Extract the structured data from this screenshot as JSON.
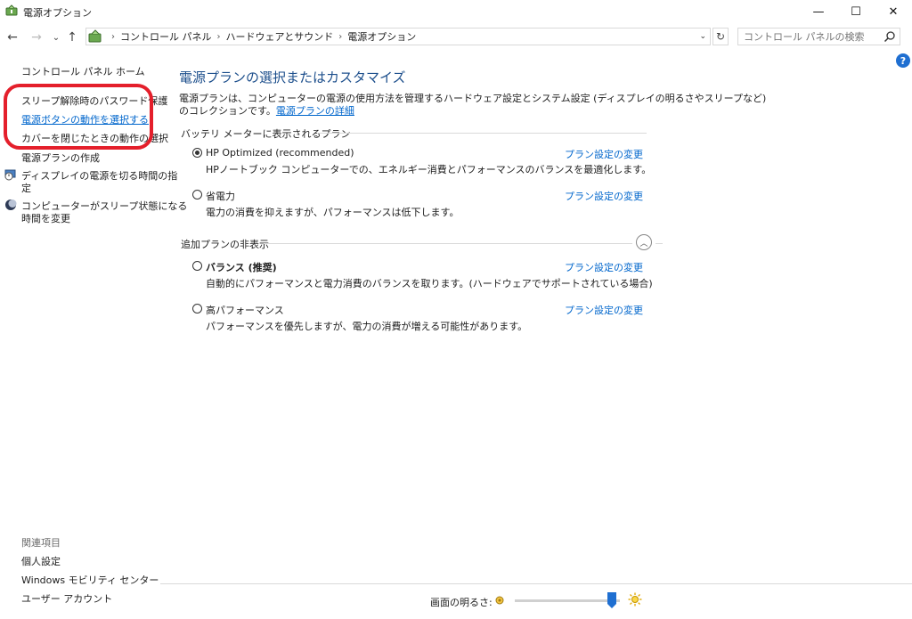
{
  "window": {
    "title": "電源オプション",
    "minimize": "—",
    "maximize": "☐",
    "close": "✕"
  },
  "nav": {
    "back": "←",
    "forward": "→",
    "recent": "⌄",
    "up": "↑"
  },
  "address": {
    "crumbs": [
      "コントロール パネル",
      "ハードウェアとサウンド",
      "電源オプション"
    ],
    "separator": "›",
    "dropdown": "⌄",
    "refresh": "↻"
  },
  "search": {
    "placeholder": "コントロール パネルの検索"
  },
  "help": "?",
  "sidebar": {
    "home": "コントロール パネル ホーム",
    "items": [
      "スリープ解除時のパスワード保護",
      "電源ボタンの動作を選択する",
      "カバーを閉じたときの動作の選択",
      "電源プランの作成",
      "ディスプレイの電源を切る時間の指定",
      "コンピューターがスリープ状態になる時間を変更"
    ],
    "item4_lines": [
      "ディスプレイの電源を切る時間の指",
      "定"
    ],
    "item5_lines": [
      "コンピューターがスリープ状態になる",
      "時間を変更"
    ],
    "related": {
      "heading": "関連項目",
      "links": [
        "個人設定",
        "Windows モビリティ センター",
        "ユーザー アカウント"
      ]
    }
  },
  "main": {
    "title": "電源プランの選択またはカスタマイズ",
    "description_line1": "電源プランは、コンピューターの電源の使用方法を管理するハードウェア設定とシステム設定 (ディスプレイの明るさやスリープなど)",
    "description_line2_prefix": "のコレクションです。",
    "description_link": "電源プランの詳細",
    "battery_section": "バッテリ メーターに表示されるプラン",
    "hidden_section": "追加プランの非表示",
    "change_link": "プラン設定の変更",
    "plans": [
      {
        "name": "HP Optimized (recommended)",
        "desc": "HPノートブック コンピューターでの、エネルギー消費とパフォーマンスのバランスを最適化します。",
        "selected": true
      },
      {
        "name": "省電力",
        "desc": "電力の消費を抑えますが、パフォーマンスは低下します。",
        "selected": false
      },
      {
        "name": "バランス (推奨)",
        "desc": "自動的にパフォーマンスと電力消費のバランスを取ります。(ハードウェアでサポートされている場合)",
        "selected": false
      },
      {
        "name": "高パフォーマンス",
        "desc": "パフォーマンスを優先しますが、電力の消費が増える可能性があります。",
        "selected": false
      }
    ]
  },
  "brightness": {
    "label": "画面の明るさ:",
    "level": 0.92
  },
  "colors": {
    "link": "#0066cc",
    "title": "#1d4f8c",
    "highlight_ring": "#e41f2b",
    "slider_thumb": "#1f6fd1"
  }
}
